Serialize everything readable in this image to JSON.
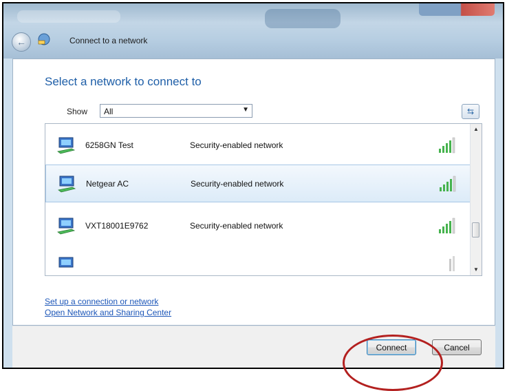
{
  "window": {
    "title": "Connect to a network"
  },
  "dialog": {
    "heading": "Select a network to connect to",
    "show_label": "Show",
    "show_value": "All"
  },
  "networks": [
    {
      "name": "6258GN Test",
      "security": "Security-enabled network",
      "selected": false,
      "signal_icon": "signal-strength-icon"
    },
    {
      "name": "Netgear AC",
      "security": "Security-enabled network",
      "selected": true,
      "signal_icon": "signal-strength-icon"
    },
    {
      "name": "VXT18001E9762",
      "security": "Security-enabled network",
      "selected": false,
      "signal_icon": "signal-strength-icon"
    }
  ],
  "links": {
    "setup": "Set up a connection or network",
    "sharing": "Open Network and Sharing Center"
  },
  "buttons": {
    "connect": "Connect",
    "cancel": "Cancel"
  },
  "colors": {
    "heading": "#1f5fa8",
    "link": "#1c56b8",
    "annotation": "#b3201f",
    "selected_row": "#dcebf8"
  }
}
